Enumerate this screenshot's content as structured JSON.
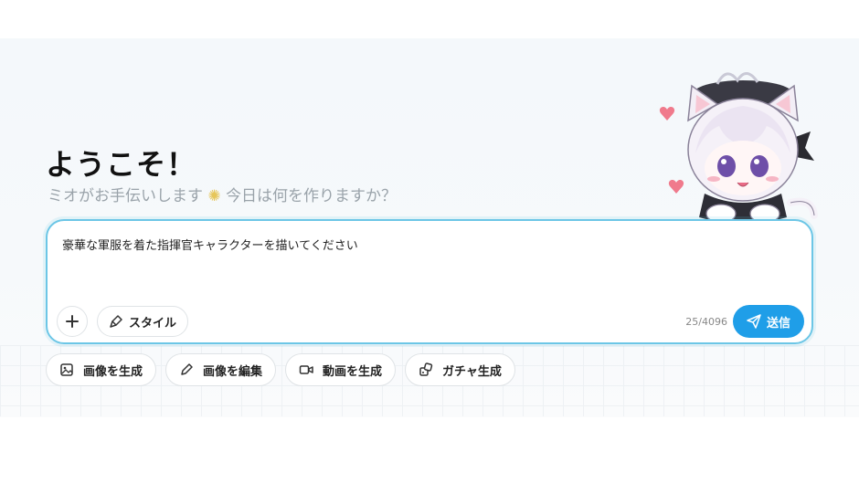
{
  "welcome": {
    "title": "ようこそ！",
    "subtitle_before": "ミオがお手伝いします",
    "subtitle_sparkle": "✺",
    "subtitle_after": "今日は何を作りますか？"
  },
  "composer": {
    "prompt_text": "豪華な軍服を着た指揮官キャラクターを描いてください",
    "add_icon": "plus-icon",
    "style_label": "スタイル",
    "style_icon": "brush-icon",
    "char_counter": "25/4096",
    "send_label": "送信",
    "send_icon": "paper-plane-icon",
    "accent_color": "#1f9ee8",
    "border_color": "#6cc6e6"
  },
  "actions": [
    {
      "label": "画像を生成",
      "icon": "image-icon"
    },
    {
      "label": "画像を編集",
      "icon": "pencil-icon"
    },
    {
      "label": "動画を生成",
      "icon": "video-camera-icon"
    },
    {
      "label": "ガチャ生成",
      "icon": "dice-icon"
    }
  ],
  "mascot": {
    "icon": "cat-girl-mascot"
  }
}
